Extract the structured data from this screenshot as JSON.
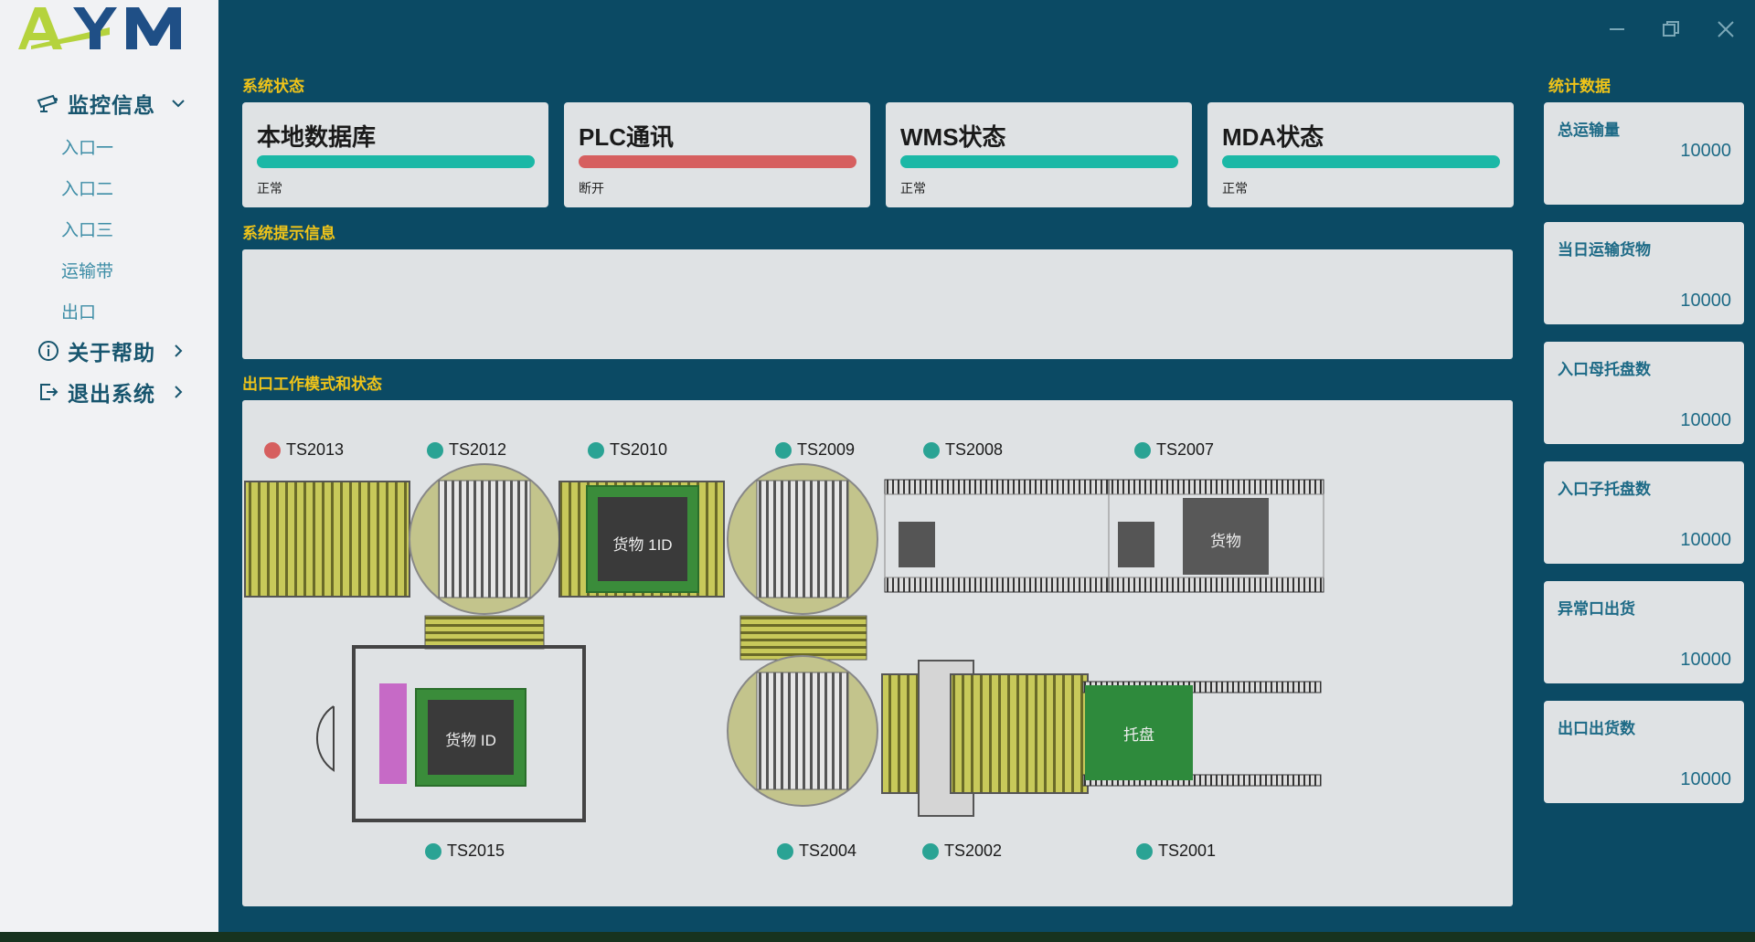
{
  "logo": {
    "text": "AYM"
  },
  "sidebar": {
    "monitor": {
      "label": "监控信息",
      "icon": "cctv-camera-icon"
    },
    "sub_items": [
      "入口一",
      "入口二",
      "入口三",
      "运输带",
      "出口"
    ],
    "help": {
      "label": "关于帮助",
      "icon": "info-circle-icon"
    },
    "exit": {
      "label": "退出系统",
      "icon": "logout-icon"
    }
  },
  "sections": {
    "system_status": "系统状态",
    "system_messages": "系统提示信息",
    "exit_mode": "出口工作模式和状态",
    "statistics": "统计数据"
  },
  "status_cards": [
    {
      "title": "本地数据库",
      "status": "正常",
      "color": "#1bb8a6"
    },
    {
      "title": "PLC通讯",
      "status": "断开",
      "color": "#d65f5f"
    },
    {
      "title": "WMS状态",
      "status": "正常",
      "color": "#1bb8a6"
    },
    {
      "title": "MDA状态",
      "status": "正常",
      "color": "#1bb8a6"
    }
  ],
  "messages": "",
  "stations": [
    {
      "id": "TS2013",
      "state": "error",
      "color": "#d65f5f"
    },
    {
      "id": "TS2012",
      "state": "ok",
      "color": "#2aa394"
    },
    {
      "id": "TS2010",
      "state": "ok",
      "color": "#2aa394"
    },
    {
      "id": "TS2009",
      "state": "ok",
      "color": "#2aa394"
    },
    {
      "id": "TS2008",
      "state": "ok",
      "color": "#2aa394"
    },
    {
      "id": "TS2007",
      "state": "ok",
      "color": "#2aa394"
    },
    {
      "id": "TS2015",
      "state": "ok",
      "color": "#2aa394"
    },
    {
      "id": "TS2004",
      "state": "ok",
      "color": "#2aa394"
    },
    {
      "id": "TS2002",
      "state": "ok",
      "color": "#2aa394"
    },
    {
      "id": "TS2001",
      "state": "ok",
      "color": "#2aa394"
    }
  ],
  "goods_labels": {
    "ts2010": "货物 1ID",
    "ts2007": "货物",
    "ts2015": "货物 ID",
    "ts2001": "托盘"
  },
  "stats": [
    {
      "label": "总运输量",
      "value": "10000"
    },
    {
      "label": "当日运输货物",
      "value": "10000"
    },
    {
      "label": "入口母托盘数",
      "value": "10000"
    },
    {
      "label": "入口子托盘数",
      "value": "10000"
    },
    {
      "label": "异常口出货",
      "value": "10000"
    },
    {
      "label": "出口出货数",
      "value": "10000"
    }
  ],
  "colors": {
    "background": "#0b4a64",
    "sidebar": "#f1f2f4",
    "accent": "#f0c419",
    "ok": "#1bb8a6",
    "error": "#d65f5f",
    "conveyor": "#c8c95a"
  }
}
